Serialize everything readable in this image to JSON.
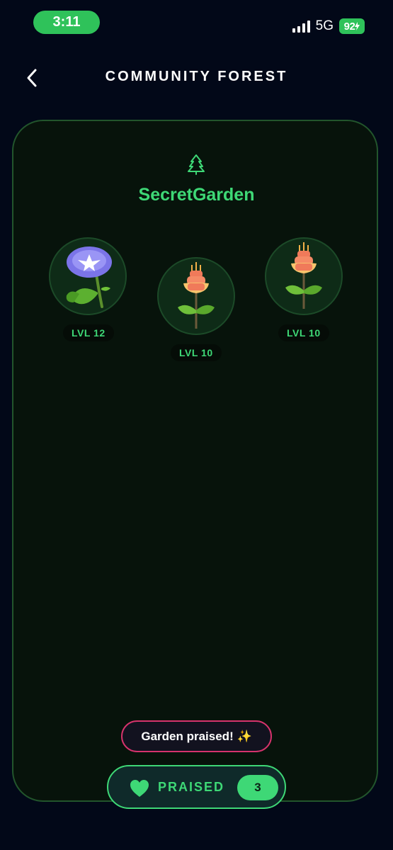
{
  "status_bar": {
    "time": "3:11",
    "network": "5G",
    "battery": "92",
    "accent_color": "#2fc25a"
  },
  "header": {
    "title": "COMMUNITY FOREST",
    "back_icon": "chevron-left-icon"
  },
  "garden": {
    "icon": "pine-tree-icon",
    "name": "SecretGarden",
    "accent_color": "#3ed876",
    "plants": [
      {
        "type": "morning-glory",
        "level": "LVL 12"
      },
      {
        "type": "hyacinth",
        "level": "LVL 10"
      },
      {
        "type": "hyacinth",
        "level": "LVL 10"
      }
    ]
  },
  "toast": {
    "text": "Garden praised! ✨",
    "border_color": "#d6336c"
  },
  "praise_button": {
    "icon": "heart-icon",
    "label": "PRAISED",
    "count": "3"
  }
}
